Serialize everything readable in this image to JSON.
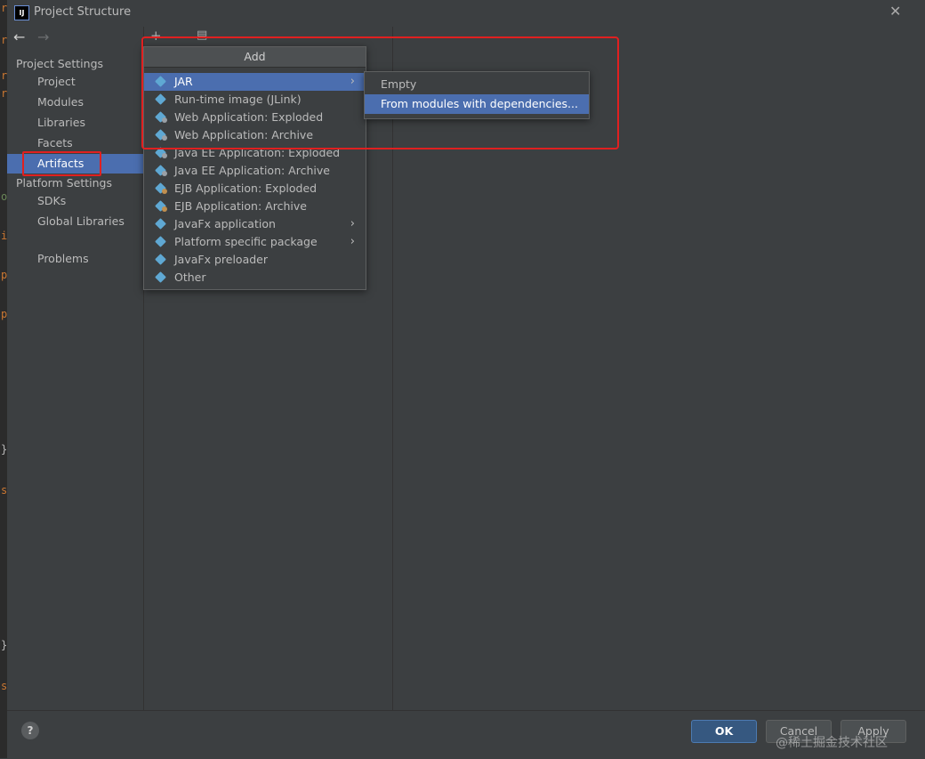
{
  "window": {
    "title": "Project Structure"
  },
  "editor_gutter": [
    "r",
    "r",
    "r",
    "r",
    "o",
    "i",
    "p",
    "p",
    "}",
    "s",
    "}",
    "s"
  ],
  "sidebar": {
    "project_settings_label": "Project Settings",
    "project_items": [
      "Project",
      "Modules",
      "Libraries",
      "Facets",
      "Artifacts"
    ],
    "selected_item": "Artifacts",
    "platform_settings_label": "Platform Settings",
    "platform_items": [
      "SDKs",
      "Global Libraries"
    ],
    "problems_label": "Problems"
  },
  "add_popup": {
    "title": "Add",
    "items": [
      {
        "label": "JAR",
        "has_submenu": true,
        "active": true
      },
      {
        "label": "Run-time image (JLink)",
        "has_submenu": false
      },
      {
        "label": "Web Application: Exploded",
        "has_submenu": false
      },
      {
        "label": "Web Application: Archive",
        "has_submenu": false
      },
      {
        "label": "Java EE Application: Exploded",
        "has_submenu": false
      },
      {
        "label": "Java EE Application: Archive",
        "has_submenu": false
      },
      {
        "label": "EJB Application: Exploded",
        "has_submenu": false
      },
      {
        "label": "EJB Application: Archive",
        "has_submenu": false
      },
      {
        "label": "JavaFx application",
        "has_submenu": true
      },
      {
        "label": "Platform specific package",
        "has_submenu": true
      },
      {
        "label": "JavaFx preloader",
        "has_submenu": false
      },
      {
        "label": "Other",
        "has_submenu": false
      }
    ]
  },
  "jar_submenu": {
    "items": [
      {
        "label": "Empty",
        "active": false
      },
      {
        "label": "From modules with dependencies...",
        "active": true
      }
    ]
  },
  "buttons": {
    "ok": "OK",
    "cancel": "Cancel",
    "apply": "Apply",
    "help": "?"
  },
  "watermark": "@稀土掘金技术社区",
  "colors": {
    "selection": "#4b6eaf",
    "annotation": "#e02020",
    "ok_button": "#365880"
  }
}
